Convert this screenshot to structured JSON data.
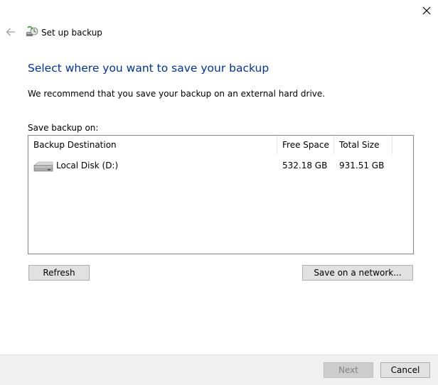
{
  "window": {
    "title": "Set up backup",
    "close_icon": "close-icon",
    "back_icon": "back-arrow-icon",
    "app_icon": "backup-icon"
  },
  "page": {
    "heading": "Select where you want to save your backup",
    "recommendation": "We recommend that you save your backup on an external hard drive.",
    "save_on_label": "Save backup on:"
  },
  "destinations": {
    "columns": {
      "destination": "Backup Destination",
      "free_space": "Free Space",
      "total_size": "Total Size"
    },
    "rows": [
      {
        "icon": "hard-disk-icon",
        "name": "Local Disk (D:)",
        "free_space": "532.18 GB",
        "total_size": "931.51 GB"
      }
    ]
  },
  "actions": {
    "refresh_label": "Refresh",
    "network_label": "Save on a network..."
  },
  "footer": {
    "next_label": "Next",
    "cancel_label": "Cancel"
  },
  "colors": {
    "heading": "#003399",
    "footer_bg": "#f0f0f0",
    "button_bg": "#e1e1e1",
    "disabled_button_bg": "#cccccc"
  }
}
